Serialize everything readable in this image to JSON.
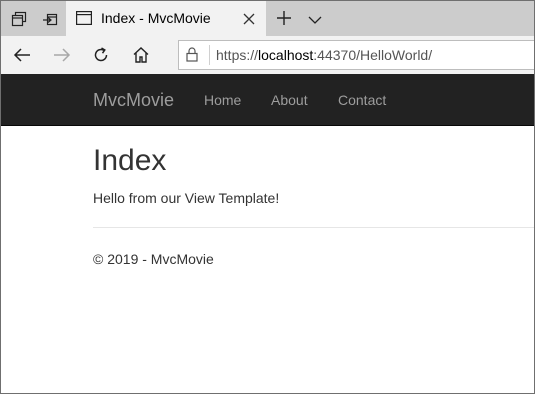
{
  "browser": {
    "tab": {
      "title": "Index - MvcMovie"
    },
    "address": {
      "scheme": "https://",
      "host": "localhost",
      "rest": ":44370/HelloWorld/"
    },
    "icons": [
      "tab-actions-icon",
      "set-aside-tabs-icon",
      "page-icon",
      "close-icon",
      "plus-icon",
      "chevron-down-icon",
      "back-arrow-icon",
      "forward-arrow-icon",
      "refresh-icon",
      "home-icon",
      "lock-icon"
    ]
  },
  "site": {
    "brand": "MvcMovie",
    "nav": [
      "Home",
      "About",
      "Contact"
    ],
    "colors": {
      "navbar": "#222222",
      "nav_text": "#9d9d9d"
    }
  },
  "page": {
    "heading": "Index",
    "message": "Hello from our View Template!",
    "footer": "© 2019 - MvcMovie"
  }
}
